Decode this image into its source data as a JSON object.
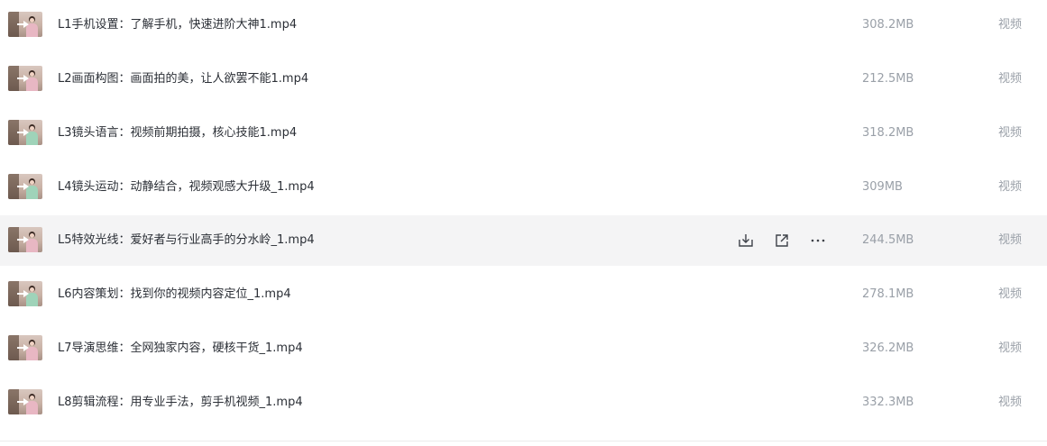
{
  "files": [
    {
      "name": "L1手机设置：了解手机，快速进阶大神1.mp4",
      "size": "308.2MB",
      "type": "视频",
      "thumb_icon": "video-thumbnail-icon"
    },
    {
      "name": "L2画面构图：画面拍的美，让人欲罢不能1.mp4",
      "size": "212.5MB",
      "type": "视频",
      "thumb_icon": "video-thumbnail-icon"
    },
    {
      "name": "L3镜头语言：视频前期拍摄，核心技能1.mp4",
      "size": "318.2MB",
      "type": "视频",
      "thumb_icon": "video-thumbnail-icon"
    },
    {
      "name": "L4镜头运动：动静结合，视频观感大升级_1.mp4",
      "size": "309MB",
      "type": "视频",
      "thumb_icon": "video-thumbnail-icon"
    },
    {
      "name": "L5特效光线：爱好者与行业高手的分水岭_1.mp4",
      "size": "244.5MB",
      "type": "视频",
      "thumb_icon": "video-thumbnail-icon"
    },
    {
      "name": "L6内容策划：找到你的视频内容定位_1.mp4",
      "size": "278.1MB",
      "type": "视频",
      "thumb_icon": "video-thumbnail-icon"
    },
    {
      "name": "L7导演思维：全网独家内容，硬核干货_1.mp4",
      "size": "326.2MB",
      "type": "视频",
      "thumb_icon": "video-thumbnail-icon"
    },
    {
      "name": "L8剪辑流程：用专业手法，剪手机视频_1.mp4",
      "size": "332.3MB",
      "type": "视频",
      "thumb_icon": "video-thumbnail-icon"
    }
  ],
  "hover_row_index": 4,
  "row_actions": [
    {
      "icon": "download-icon"
    },
    {
      "icon": "share-icon"
    },
    {
      "icon": "more-icon"
    }
  ],
  "colors": {
    "hover_background": "#f4f4f5",
    "name_text": "#2b2f36",
    "meta_text": "#9aa0a8",
    "icon": "#3d4148"
  }
}
